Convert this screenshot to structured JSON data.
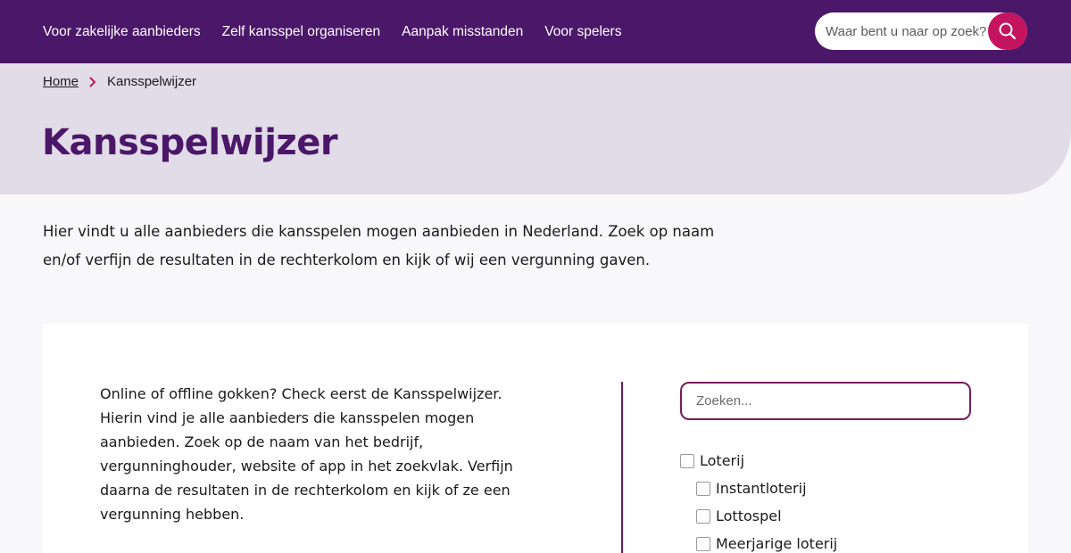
{
  "nav": {
    "links": [
      "Voor zakelijke aanbieders",
      "Zelf kansspel organiseren",
      "Aanpak misstanden",
      "Voor spelers"
    ],
    "search_placeholder": "Waar bent u naar op zoek?",
    "search_icon": "search-icon"
  },
  "breadcrumb": {
    "home": "Home",
    "current": "Kansspelwijzer",
    "separator_icon": "chevron-right-icon"
  },
  "page": {
    "title": "Kansspelwijzer",
    "intro_line1": "Hier vindt u alle aanbieders die kansspelen mogen aanbieden in Nederland. Zoek op naam",
    "intro_line2": "en/of verfijn de resultaten in de rechterkolom en kijk of wij een vergunning gaven."
  },
  "card": {
    "text_lines": [
      "Online of offline gokken? Check eerst de Kansspelwijzer.",
      "Hierin vind je alle aanbieders die kansspelen mogen",
      "aanbieden. Zoek op de naam van het bedrijf,",
      "vergunninghouder, website of app in het zoekvlak. Verfijn",
      "daarna de resultaten in de rechterkolom en kijk of ze een",
      "vergunning hebben."
    ],
    "search_placeholder": "Zoeken...",
    "filters": {
      "top": "Loterij",
      "sub": [
        "Instantloterij",
        "Lottospel",
        "Meerjarige loterij"
      ]
    }
  },
  "colors": {
    "nav_bg": "#4b1769",
    "hero_bg": "#e2dbe8",
    "accent": "#c4145f",
    "title": "#4b1769",
    "divider": "#7a1b5c"
  }
}
